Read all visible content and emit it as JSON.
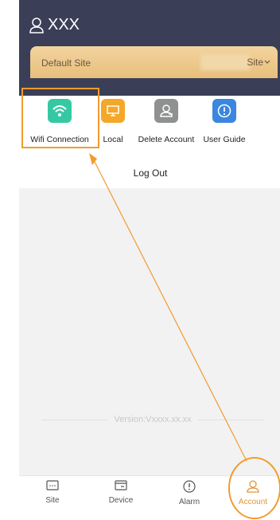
{
  "header": {
    "user_name": "XXX"
  },
  "site_card": {
    "default_label": "Default Site",
    "site_label": "Site"
  },
  "quick_actions": [
    {
      "label": "Wifi Connection",
      "icon": "wifi-icon",
      "color": "#35c9a3"
    },
    {
      "label": "Local",
      "icon": "monitor-icon",
      "color": "#f5a72a"
    },
    {
      "label": "Delete Account",
      "icon": "user-remove-icon",
      "color": "#8f9090"
    },
    {
      "label": "User Guide",
      "icon": "info-bubble-icon",
      "color": "#3a86e0"
    }
  ],
  "logout_label": "Log Out",
  "version_text": "Version:Vxxxx.xx.xx",
  "bottom_nav": [
    {
      "label": "Site",
      "icon": "site-icon"
    },
    {
      "label": "Device",
      "icon": "device-icon"
    },
    {
      "label": "Alarm",
      "icon": "alarm-icon"
    },
    {
      "label": "Account",
      "icon": "account-icon",
      "active": true
    }
  ],
  "colors": {
    "header_bg": "#3a3f57",
    "annotation": "#f29b2e",
    "accent": "#e0963a"
  }
}
